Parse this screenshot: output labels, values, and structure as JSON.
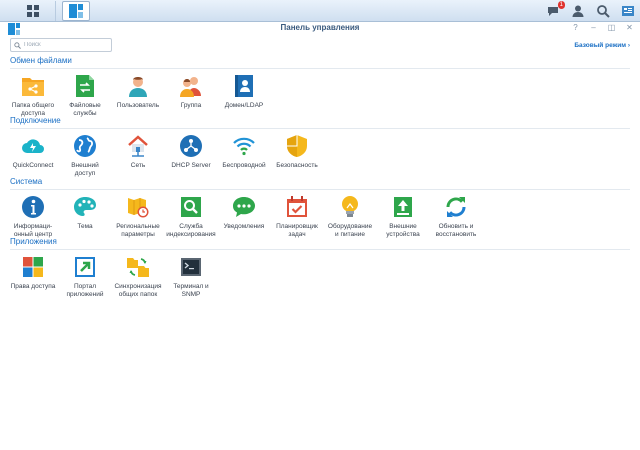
{
  "window": {
    "title": "Панель управления",
    "controls": [
      "?",
      "–",
      "◫",
      "✕"
    ]
  },
  "taskbar": {
    "notification_count": "1"
  },
  "search": {
    "placeholder": "Поиск"
  },
  "mode_link": {
    "label": "Базовый режим"
  },
  "sections": [
    {
      "title": "Обмен файлами",
      "items": [
        {
          "label": "Папка общего\nдоступа",
          "icon": "shared-folder-icon"
        },
        {
          "label": "Файловые\nслужбы",
          "icon": "file-services-icon"
        },
        {
          "label": "Пользователь",
          "icon": "user-icon"
        },
        {
          "label": "Группа",
          "icon": "group-icon"
        },
        {
          "label": "Домен/LDAP",
          "icon": "domain-ldap-icon"
        }
      ]
    },
    {
      "title": "Подключение",
      "items": [
        {
          "label": "QuickConnect",
          "icon": "quickconnect-icon"
        },
        {
          "label": "Внешний\nдоступ",
          "icon": "external-access-icon"
        },
        {
          "label": "Сеть",
          "icon": "network-icon"
        },
        {
          "label": "DHCP Server",
          "icon": "dhcp-server-icon"
        },
        {
          "label": "Беспроводной",
          "icon": "wireless-icon"
        },
        {
          "label": "Безопасность",
          "icon": "security-icon"
        }
      ]
    },
    {
      "title": "Система",
      "items": [
        {
          "label": "Информаци-\nонный центр",
          "icon": "info-center-icon"
        },
        {
          "label": "Тема",
          "icon": "theme-icon"
        },
        {
          "label": "Региональные\nпараметры",
          "icon": "regional-options-icon"
        },
        {
          "label": "Служба\nиндексирования",
          "icon": "indexing-service-icon"
        },
        {
          "label": "Уведомления",
          "icon": "notification-icon"
        },
        {
          "label": "Планировщик\nзадач",
          "icon": "task-scheduler-icon"
        },
        {
          "label": "Оборудование\nи питание",
          "icon": "hardware-power-icon"
        },
        {
          "label": "Внешние\nустройства",
          "icon": "external-devices-icon"
        },
        {
          "label": "Обновить и\nвосстановить",
          "icon": "update-restore-icon"
        }
      ]
    },
    {
      "title": "Приложения",
      "items": [
        {
          "label": "Права доступа",
          "icon": "privileges-icon"
        },
        {
          "label": "Портал\nприложений",
          "icon": "application-portal-icon"
        },
        {
          "label": "Синхронизация\nобщих папок",
          "icon": "shared-folder-sync-icon"
        },
        {
          "label": "Терминал и\nSNMP",
          "icon": "terminal-snmp-icon"
        }
      ]
    }
  ]
}
